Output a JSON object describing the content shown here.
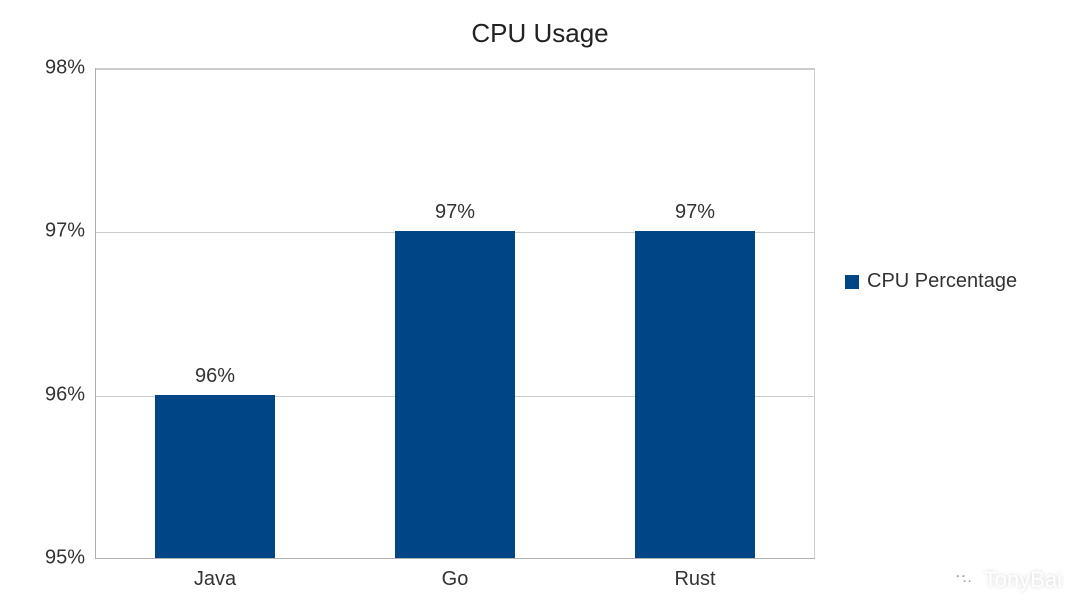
{
  "chart_data": {
    "type": "bar",
    "title": "CPU Usage",
    "categories": [
      "Java",
      "Go",
      "Rust"
    ],
    "values": [
      96,
      97,
      97
    ],
    "series_name": "CPU Percentage",
    "ylabel": "",
    "xlabel": "",
    "ylim": [
      95,
      98
    ],
    "yticks": [
      95,
      96,
      97,
      98
    ],
    "ytick_labels": [
      "95%",
      "96%",
      "97%",
      "98%"
    ],
    "value_labels": [
      "96%",
      "97%",
      "97%"
    ],
    "bar_color": "#004586",
    "legend_position": "right"
  },
  "watermark": {
    "text": "TonyBai"
  }
}
